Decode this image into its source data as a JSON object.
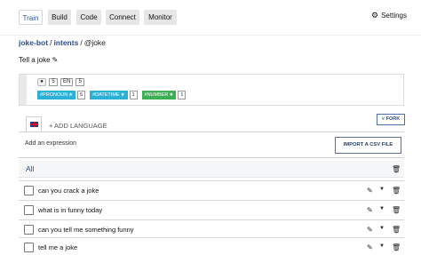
{
  "nav": {
    "tabs": [
      {
        "label": "Train"
      },
      {
        "label": "Build"
      },
      {
        "label": "Code"
      },
      {
        "label": "Connect"
      },
      {
        "label": "Monitor"
      }
    ],
    "active_tab": "Train",
    "settings_label": "Settings",
    "settings_icon": "gear-icon"
  },
  "breadcrumb": {
    "project": "joke-bot",
    "section": "intents",
    "current": "@joke"
  },
  "intent": {
    "title": "Tell a joke",
    "edit_icon": "pencil-icon"
  },
  "stats": {
    "examples_count": "5",
    "language_code": "EN",
    "language_count": "5",
    "entities": [
      {
        "name": "#PRONOUN",
        "count": "5",
        "color": "#2bb0d6"
      },
      {
        "name": "#DATETIME",
        "count": "1",
        "color": "#2bb0d6"
      },
      {
        "name": "#NUMBER",
        "count": "1",
        "color": "#3cae54"
      }
    ]
  },
  "language": {
    "add_label": "+ ADD LANGUAGE",
    "flag_icon": "uk-flag-icon",
    "fork_label": "FORK"
  },
  "expressions": {
    "add_placeholder": "Add an expression",
    "import_label": "IMPORT A CSV FILE",
    "all_label": "All",
    "items": [
      {
        "text": "can you crack a joke"
      },
      {
        "text": "what is in funny today"
      },
      {
        "text": "can you tell me something funny"
      },
      {
        "text": "tell me a joke"
      }
    ]
  },
  "colors": {
    "accent": "#2a4f8a",
    "pronoun": "#2bb0d6",
    "number": "#3cae54"
  }
}
